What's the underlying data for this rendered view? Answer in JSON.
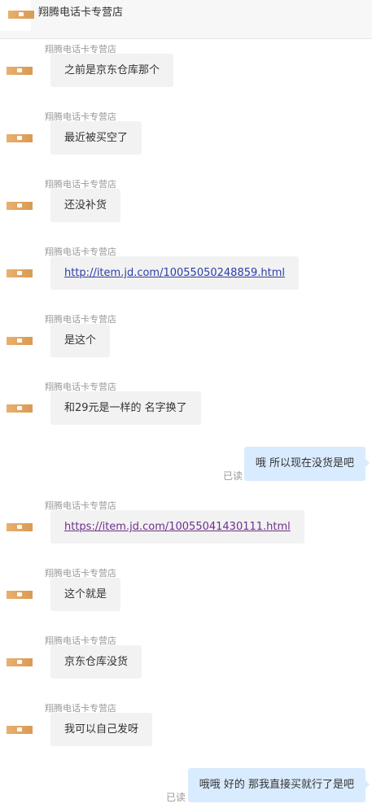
{
  "header": {
    "title": "翔腾电话卡专营店"
  },
  "messages": [
    {
      "sender": "翔腾电话卡专营店",
      "text": "之前是京东仓库那个"
    },
    {
      "sender": "翔腾电话卡专营店",
      "text": "最近被买空了"
    },
    {
      "sender": "翔腾电话卡专营店",
      "text": "还没补货"
    },
    {
      "sender": "翔腾电话卡专营店",
      "link": "http://item.jd.com/10055050248859.html"
    },
    {
      "sender": "翔腾电话卡专营店",
      "text": "是这个"
    },
    {
      "sender": "翔腾电话卡专营店",
      "text": "和29元是一样的 名字换了"
    },
    {
      "out_text": "哦 所以现在没货是吧",
      "status": "已读"
    },
    {
      "sender": "翔腾电话卡专营店",
      "link": "https://item.jd.com/10055041430111.html"
    },
    {
      "sender": "翔腾电话卡专营店",
      "text": "这个就是"
    },
    {
      "sender": "翔腾电话卡专营店",
      "text": "京东仓库没货"
    },
    {
      "sender": "翔腾电话卡专营店",
      "text": "我可以自己发呀"
    },
    {
      "out_text": "哦哦 好的 那我直接买就行了是吧",
      "status": "已读"
    }
  ],
  "colors": {
    "shop_icon": "#e0a25c",
    "incoming_bubble": "#f2f2f2",
    "outgoing_bubble": "#d9ebff",
    "link": "#2b3ea8",
    "visited_link": "#6f2f8c"
  },
  "icons": {
    "shop_avatar": "shop-icon"
  }
}
